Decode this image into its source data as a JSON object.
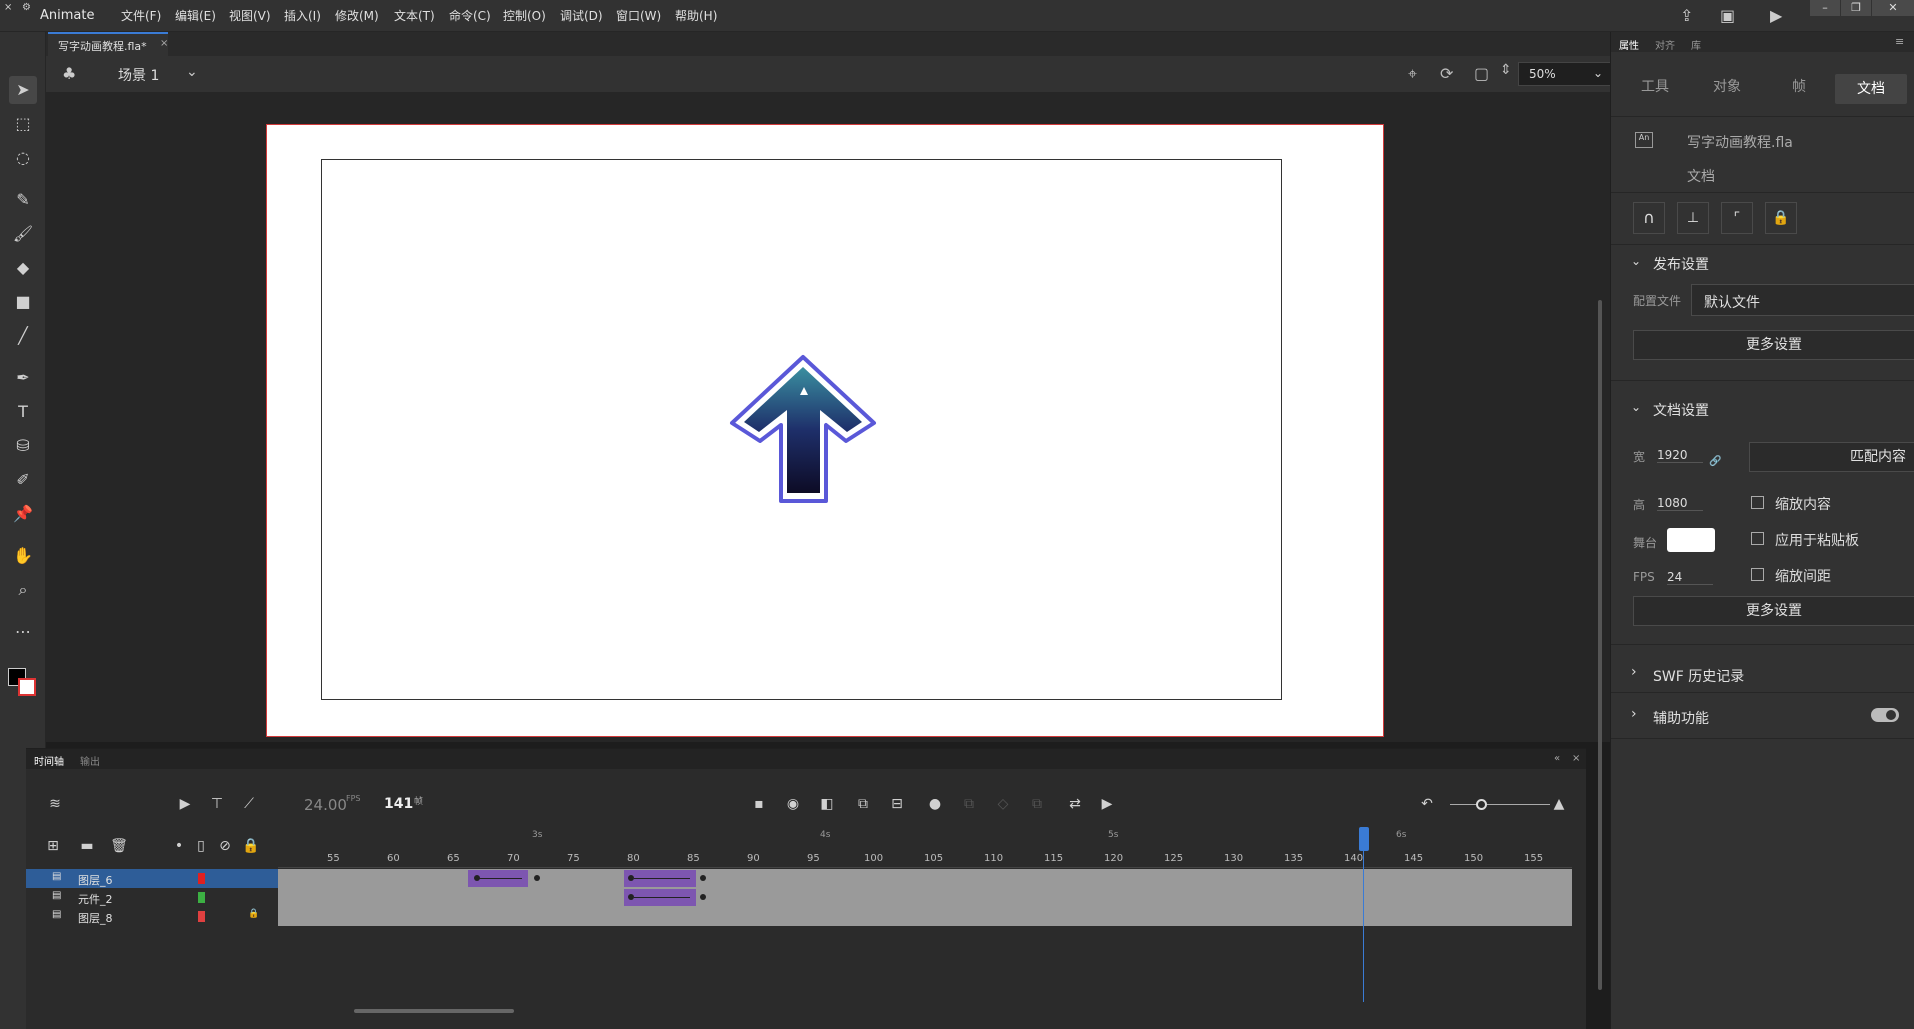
{
  "app": {
    "name": "Animate"
  },
  "menu": [
    "文件(F)",
    "编辑(E)",
    "视图(V)",
    "插入(I)",
    "修改(M)",
    "文本(T)",
    "命令(C)",
    "控制(O)",
    "调试(D)",
    "窗口(W)",
    "帮助(H)"
  ],
  "doc_tab": {
    "label": "写字动画教程.fla*"
  },
  "scene": {
    "label": "场景 1",
    "zoom": "50%"
  },
  "right_panel": {
    "top_tabs": [
      "属性",
      "对齐",
      "库"
    ],
    "tabs": [
      "工具",
      "对象",
      "帧",
      "文档"
    ],
    "file_name": "写字动画教程.fla",
    "doc_type": "文档",
    "publish_header": "发布设置",
    "profile_label": "配置文件",
    "profile_value": "默认文件",
    "more_settings": "更多设置",
    "doc_settings_header": "文档设置",
    "width_label": "宽",
    "width_value": "1920",
    "height_label": "高",
    "height_value": "1080",
    "stage_label": "舞台",
    "fps_label": "FPS",
    "fps_value": "24",
    "match_content": "匹配内容",
    "scale_content": "缩放内容",
    "apply_pasteboard": "应用于粘贴板",
    "scale_spacing": "缩放间距",
    "more_settings2": "更多设置",
    "swf_history": "SWF 历史记录",
    "accessibility": "辅助功能"
  },
  "timeline": {
    "tabs": [
      "时间轴",
      "输出"
    ],
    "fps_value": "24.00",
    "fps_unit": "FPS",
    "frame_value": "141",
    "frame_unit": "帧",
    "seconds": [
      "3s",
      "4s",
      "5s",
      "6s"
    ],
    "ticks": [
      "55",
      "60",
      "65",
      "70",
      "75",
      "80",
      "85",
      "90",
      "95",
      "100",
      "105",
      "110",
      "115",
      "120",
      "125",
      "130",
      "135",
      "140",
      "145",
      "150",
      "155"
    ],
    "layers": [
      {
        "name": "图层_6",
        "color": "#e02020",
        "locked": false,
        "selected": true
      },
      {
        "name": "元件_2",
        "color": "#3cb043",
        "locked": false,
        "selected": false
      },
      {
        "name": "图层_8",
        "color": "#e04040",
        "locked": true,
        "selected": false
      }
    ],
    "playhead_frame": 141
  },
  "colors": {
    "accent": "#3a7bd5",
    "tween": "#7d56b0",
    "stage_border": "#d23a3a"
  }
}
